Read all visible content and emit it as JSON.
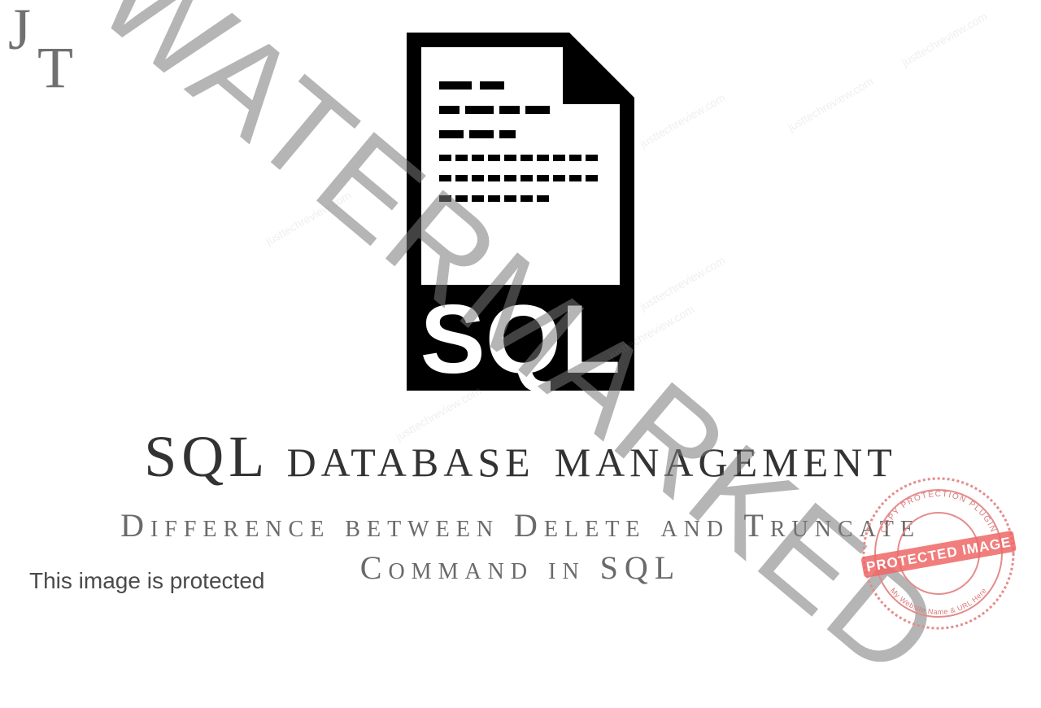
{
  "logo": {
    "line1": "J",
    "line2": "T"
  },
  "icon": {
    "label": "SQL"
  },
  "headline": "SQL database management",
  "subline": "Difference between Delete and Truncate Command in SQL",
  "watermark": {
    "diagonal": "WATERMARKED",
    "url": "justtechreview.com",
    "protected_note": "This image is protected"
  },
  "stamp": {
    "outer_top": "COPY PROTECTION PLUGIN",
    "band": "PROTECTED IMAGE",
    "outer_bottom": "My Website Name & URL Here"
  }
}
